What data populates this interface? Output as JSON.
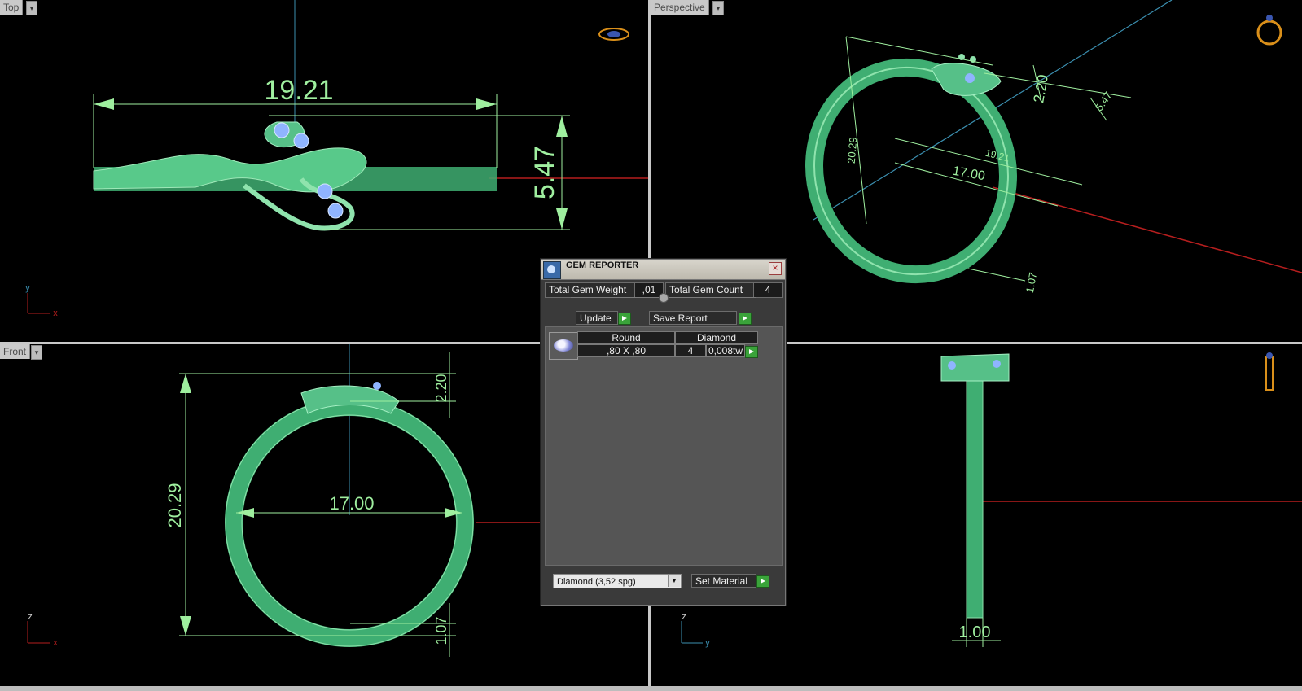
{
  "viewports": {
    "top": {
      "label": "Top",
      "dims": {
        "length": "19.21",
        "height": "5.47"
      },
      "axes": {
        "a": "y",
        "b": "x"
      }
    },
    "perspective": {
      "label": "Perspective",
      "dims": {
        "d1": "20.29",
        "d2": "17.00",
        "d3": "19.21",
        "d4": "2.20",
        "d5": "5.47",
        "d6": "1.07"
      }
    },
    "front": {
      "label": "Front",
      "dims": {
        "height": "20.29",
        "inner": "17.00",
        "top": "2.20",
        "bottom": "1.07"
      },
      "axes": {
        "a": "z",
        "b": "x"
      }
    },
    "right": {
      "dims": {
        "width": "1.00"
      },
      "axes": {
        "a": "z",
        "b": "y"
      }
    }
  },
  "colors": {
    "ring": "#3fae72",
    "dim": "#9fef9f",
    "gem": "#8fb4ff",
    "axis_blue": "#3b8fb0",
    "axis_red": "#b61e1e"
  },
  "gem_reporter": {
    "title": "GEM REPORTER",
    "total_weight_label": "Total Gem Weight",
    "total_weight_value": ",01",
    "total_count_label": "Total Gem Count",
    "total_count_value": "4",
    "update_label": "Update",
    "save_report_label": "Save Report",
    "table": {
      "shape_header": "Round",
      "material_header": "Diamond",
      "size": ",80 X ,80",
      "count": "4",
      "weight": "0,008tw"
    },
    "material_select": "Diamond      (3,52 spg)",
    "set_material_label": "Set Material"
  }
}
